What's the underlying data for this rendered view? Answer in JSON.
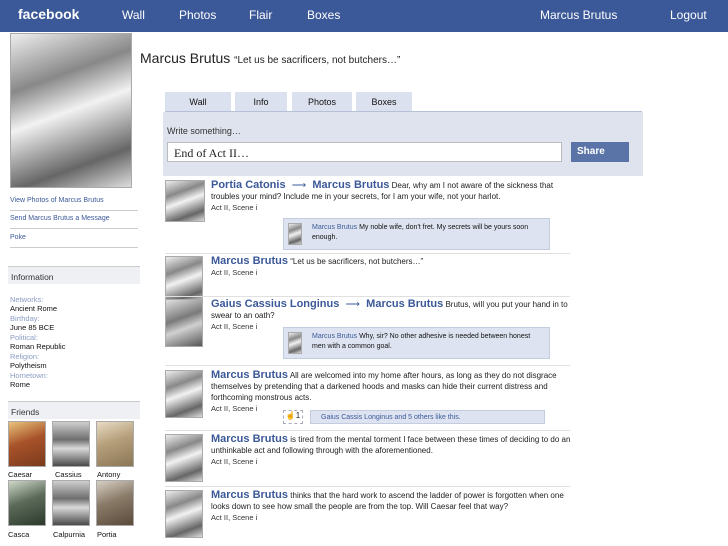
{
  "topnav": {
    "brand": "facebook",
    "items": [
      "Wall",
      "Photos",
      "Flair",
      "Boxes"
    ],
    "user": "Marcus Brutus",
    "logout": "Logout"
  },
  "profile": {
    "name": "Marcus Brutus",
    "status": "“Let us be sacrificers, not butchers…”"
  },
  "tabs": [
    "Wall",
    "Info",
    "Photos",
    "Boxes"
  ],
  "composer": {
    "label": "Write something…",
    "value": "End of Act II…",
    "share": "Share"
  },
  "sidebar": {
    "links": [
      "View Photos of Marcus Brutus",
      "Send Marcus Brutus a Message",
      "Poke"
    ],
    "info_title": "Information",
    "info": [
      {
        "k": "Networks:",
        "v": "Ancient Rome"
      },
      {
        "k": "Birthday:",
        "v": "June 85 BCE"
      },
      {
        "k": "Political:",
        "v": "Roman Republic"
      },
      {
        "k": "Religion:",
        "v": "Polytheism"
      },
      {
        "k": "Hometown:",
        "v": "Rome"
      }
    ],
    "friends_title": "Friends",
    "friends": [
      "Caesar",
      "Cassius",
      "Antony",
      "Casca",
      "Calpurnia",
      "Portia"
    ]
  },
  "posts": [
    {
      "from": "Portia Catonis",
      "to": "Marcus Brutus",
      "text": "Dear, why am I not aware of the sickness that troubles your mind? Include me in your secrets, for I am your wife, not your harlot.",
      "meta": "Act II, Scene i",
      "comment": {
        "name": "Marcus Brutus",
        "text": "My noble wife, don't fret. My secrets will be yours soon enough."
      }
    },
    {
      "from": "Marcus Brutus",
      "text": "“Let us be sacrificers, not butchers…”",
      "meta": "Act II, Scene i"
    },
    {
      "from": "Gaius Cassius Longinus",
      "to": "Marcus Brutus",
      "text": "Brutus, will you put your hand in to swear to an oath?",
      "meta": "Act II, Scene i",
      "comment": {
        "name": "Marcus Brutus",
        "text": "Why, sir? No other adhesive is needed between honest men with a common goal."
      }
    },
    {
      "from": "Marcus Brutus",
      "text": "All are welcomed into my home after hours, as long as they do not disgrace themselves by pretending that a darkened hoods and masks can hide their current distress and forthcoming monstrous acts.",
      "meta": "Act II, Scene i",
      "like": {
        "count": "1",
        "text": "Gaius Cassis Longinus and 5 others like this."
      }
    },
    {
      "from": "Marcus Brutus",
      "text": "is tired from the mental torment I face between these times of deciding to do an unthinkable act and following through with the aforementioned.",
      "meta": "Act II, Scene i"
    },
    {
      "from": "Marcus Brutus",
      "text": "thinks that the hard work to ascend the ladder of power is forgotten when one looks down to see how small the people are from the top. Will Caesar feel that way?",
      "meta": "Act II, Scene i"
    }
  ]
}
